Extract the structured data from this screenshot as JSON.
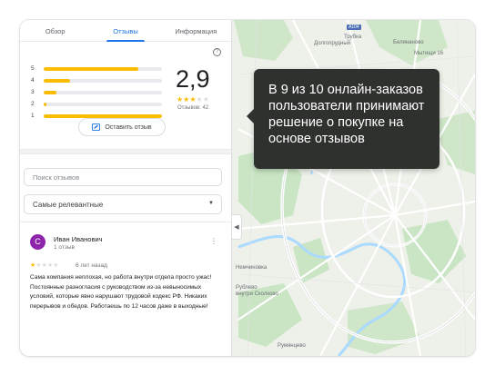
{
  "tabs": [
    {
      "label": "Обзор",
      "active": false
    },
    {
      "label": "Отзывы",
      "active": true
    },
    {
      "label": "Информация",
      "active": false
    }
  ],
  "summary": {
    "help_icon": "help-circle-icon",
    "rating": "2,9",
    "stars_filled": 3,
    "stars_total": 5,
    "review_count": "Отзывов: 42",
    "distribution": [
      {
        "stars": "5",
        "fraction": 0.8
      },
      {
        "stars": "4",
        "fraction": 0.22
      },
      {
        "stars": "3",
        "fraction": 0.11
      },
      {
        "stars": "2",
        "fraction": 0.02
      },
      {
        "stars": "1",
        "fraction": 1.0
      }
    ],
    "write_review_label": "Оставить отзыв",
    "bar_color": "#fbbc04"
  },
  "search": {
    "placeholder": "Поиск отзывов"
  },
  "sort": {
    "selected": "Самые релевантные"
  },
  "review": {
    "avatar_letter": "С",
    "avatar_color": "#8e24aa",
    "author": "Иван Иванович",
    "author_sub": "1 отзыв",
    "stars_filled": 1,
    "date": "6 лет назад",
    "text": "Сама компания неплохая, но работа внутри отдела просто ужас! Постоянные разногласия с руководством из-за невыносимых условий, которые явно нарушают трудовой кодекс РФ. Никаких перерывов и обедов. Работаешь по 12 часов даже в выходные!"
  },
  "tooltip": {
    "text": "В 9 из 10 онлайн-заказов пользователи принимают решение о покупке на основе отзывов"
  },
  "map": {
    "labels": {
      "dolgoprudny": "Долгопрудный",
      "beljanovo": "Белянаново",
      "mytishchi": "Мытищи 16",
      "trubka": "Трубка",
      "nemchinovka": "Немчиновка",
      "vnutri_skolkovo": "внутри Сколково",
      "rumjantsevo": "Румянцево",
      "rublevo": "Рублево",
      "a104": "A104"
    },
    "accent_green": "#c7e8c4",
    "water": "#aadaff",
    "road": "#ffffff"
  }
}
